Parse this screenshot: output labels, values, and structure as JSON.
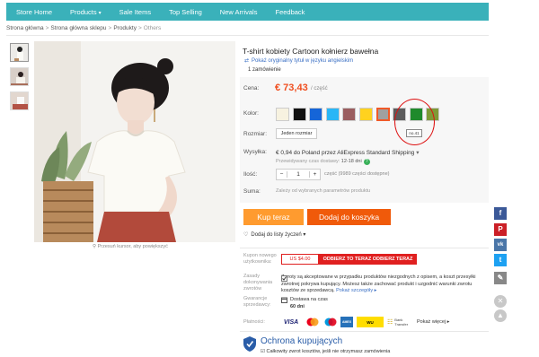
{
  "nav": {
    "items": [
      {
        "label": "Store Home"
      },
      {
        "label": "Products",
        "caret": "▾"
      },
      {
        "label": "Sale Items"
      },
      {
        "label": "Top Selling"
      },
      {
        "label": "New Arrivals"
      },
      {
        "label": "Feedback"
      }
    ]
  },
  "breadcrumb": {
    "items": [
      "Strona główna",
      "Strona główna sklepu",
      "Produkty",
      "Others"
    ],
    "separator": ">"
  },
  "gallery": {
    "zoom_hint": "Przesuń kursor, aby powiększyć"
  },
  "product": {
    "title": "T-shirt kobiety Cartoon kołnierz bawełna",
    "translate_link": "Pokaż oryginalny tytuł w języku angielskim",
    "orders": "1 zamówienie",
    "price_label": "Cena:",
    "price": "€ 73,43",
    "price_unit": "/ część",
    "color_label": "Kolor:",
    "colors": [
      "#f7f2e0",
      "#111111",
      "#1565d8",
      "#29b6f6",
      "#9b5e60",
      "#ffd21f",
      "#a0a0a0",
      "#5c5c5c",
      "#1f8a2c",
      "#7e9a36"
    ],
    "selected_color_index": 6,
    "color_tooltip": "no.41",
    "size_label": "Rozmiar:",
    "size_value": "Jeden rozmiar",
    "shipping_label": "Wysyłka:",
    "shipping_text": "€ 0,94 do Poland przez AliExpress Standard Shipping",
    "shipping_caret": "▾",
    "eta_prefix": "Przewidywany czas dostawy:",
    "eta_value": "12-18 dni",
    "qty_label": "Ilość:",
    "qty_value": "1",
    "qty_minus": "−",
    "qty_plus": "+",
    "qty_info": "część (9989 części dostępne)",
    "sum_label": "Suma:",
    "sum_text": "Zależy od wybranych parametrów produktu",
    "buy_now": "Kup teraz",
    "add_to_cart": "Dodaj do koszyka",
    "wishlist": "Dodaj do listy życzeń",
    "wishlist_caret": "▾"
  },
  "guarantees": {
    "coupon_label": "Kupon nowego użytkownika:",
    "coupon_value": "US $4.00",
    "coupon_button": "ODBIERZ TO TERAZ ODBIERZ TERAZ",
    "returns_label": "Zasady dokonywania zwrotów",
    "returns_text": "Zwroty są akceptowane w przypadku produktów niezgodnych z opisem, a koszt przesyłki zwrotnej pokrywa kupujący. Możesz także zachować produkt i uzgodnić warunki zwrotu kosztów ze sprzedawcą.",
    "returns_link": "Pokaż szczegóły",
    "seller_label": "Gwarancje sprzedawcy:",
    "delivery_line": "Dostawa na czas",
    "delivery_days": "60 dni",
    "payment_label": "Płatności:",
    "payment_methods": [
      "VISA",
      "MC",
      "Maestro",
      "AMEX",
      "WU",
      "Bank Transfer"
    ],
    "payment_more": "Pokaż więcej"
  },
  "protection": {
    "title": "Ochrona kupujących",
    "line": "Całkowity zwrot kosztów, jeśli nie otrzymasz zamówienia"
  },
  "social": {
    "facebook": "f",
    "pinterest": "P",
    "vk": "vk",
    "twitter": "t"
  }
}
